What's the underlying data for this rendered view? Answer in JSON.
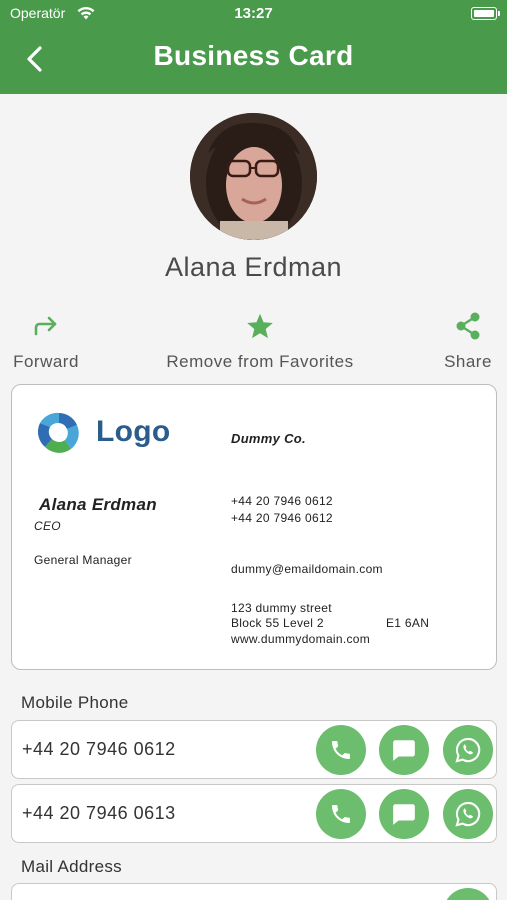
{
  "status": {
    "carrier": "Operatör",
    "time": "13:27"
  },
  "header": {
    "title": "Business Card"
  },
  "contact": {
    "name": "Alana Erdman"
  },
  "actions": {
    "forward": "Forward",
    "favorite": "Remove from Favorites",
    "share": "Share"
  },
  "card": {
    "logo_text": "Logo",
    "company": "Dummy Co.",
    "name": "Alana Erdman",
    "title": "CEO",
    "role": "General Manager",
    "phone1": "+44 20 7946 0612",
    "phone2": "+44 20 7946 0612",
    "email": "dummy@emaildomain.com",
    "address1": "123 dummy street",
    "address2": "Block 55 Level 2",
    "postcode": "E1 6AN",
    "website": "www.dummydomain.com"
  },
  "mobile": {
    "label": "Mobile Phone",
    "numbers": [
      "+44 20 7946 0612",
      "+44 20 7946 0613"
    ]
  },
  "mail": {
    "label": "Mail Address"
  },
  "colors": {
    "primary": "#4a9a4c",
    "button": "#6cbd6d"
  }
}
